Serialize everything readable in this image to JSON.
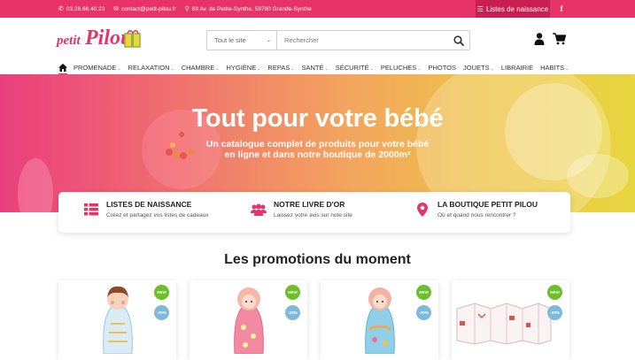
{
  "topbar": {
    "phone": "03.28.66.40.23",
    "email": "contact@petit-pilou.fr",
    "address": "69 Av. de Petite-Synthe, 59760 Grande-Synthe",
    "registry_label": "Listes de naissance",
    "facebook_label": "f"
  },
  "header": {
    "logo_word1": "petit",
    "logo_word2": "Pilou",
    "search_scope": "Tout le site",
    "search_placeholder": "Rechercher"
  },
  "nav": {
    "items": [
      {
        "label": "PROMENADE",
        "caret": "⌄"
      },
      {
        "label": "RELAXATION",
        "caret": "⌄"
      },
      {
        "label": "CHAMBRE",
        "caret": "⌄"
      },
      {
        "label": "HYGIÈNE",
        "caret": "⌄"
      },
      {
        "label": "REPAS",
        "caret": "⌄"
      },
      {
        "label": "SANTÉ",
        "caret": "⌄"
      },
      {
        "label": "SÉCURITÉ",
        "caret": "⌄"
      },
      {
        "label": "PELUCHES",
        "caret": "⌄"
      },
      {
        "label": "PHOTOS",
        "caret": ""
      },
      {
        "label": "JOUETS",
        "caret": "⌄"
      },
      {
        "label": "LIBRAIRIE",
        "caret": ""
      },
      {
        "label": "HABITS",
        "caret": "⌄"
      }
    ]
  },
  "hero": {
    "title": "Tout pour votre bébé",
    "subtitle_line1": "Un catalogue complet de produits pour votre bébé",
    "subtitle_line2": "en ligne et dans notre boutique de 2000m²"
  },
  "features": [
    {
      "title": "LISTES DE NAISSANCE",
      "subtitle": "Créez et partagez vos listes de cadeaux",
      "icon": "list-icon"
    },
    {
      "title": "NOTRE LIVRE D'OR",
      "subtitle": "Laissez votre avis sur note site",
      "icon": "users-icon"
    },
    {
      "title": "LA BOUTIQUE PETIT PILOU",
      "subtitle": "Où et quand nous rencontrer ?",
      "icon": "map-marker-icon"
    }
  ],
  "promotions": {
    "title": "Les promotions du moment",
    "badge_new": "NEW",
    "badge_sale": "-20%"
  },
  "colors": {
    "accent": "#e8336a",
    "accent_dark": "#c81e52",
    "new_badge": "#6bbf2a",
    "sale_badge": "#7eb9dc"
  }
}
